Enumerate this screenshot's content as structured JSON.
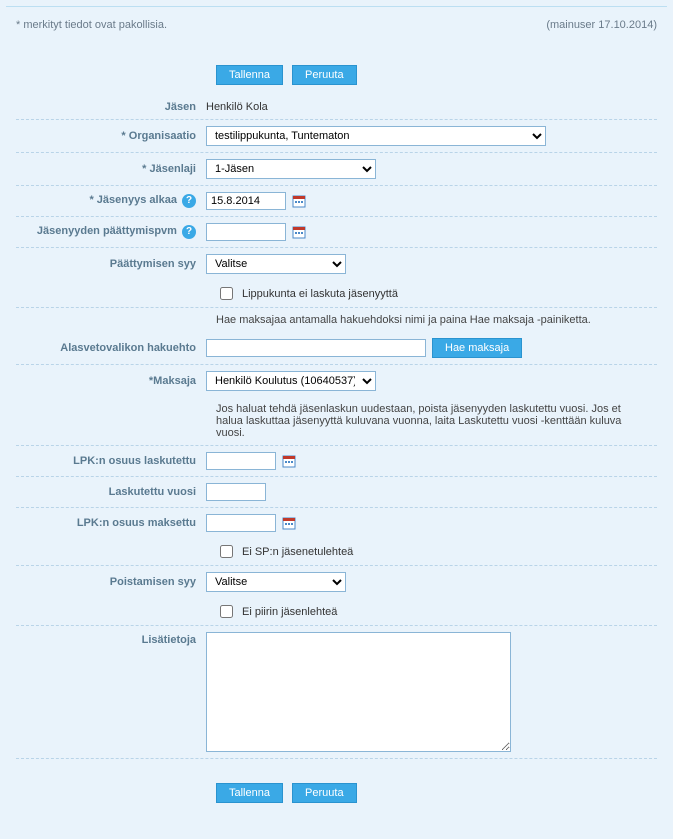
{
  "header": {
    "mandatory_note": "* merkityt tiedot ovat pakollisia.",
    "meta": "(mainuser 17.10.2014)"
  },
  "buttons": {
    "save": "Tallenna",
    "cancel": "Peruuta",
    "search_payer": "Hae maksaja"
  },
  "icons": {
    "help": "?"
  },
  "fields": {
    "member": {
      "label": "Jäsen",
      "value": "Henkilö Kola"
    },
    "organisation": {
      "label": "* Organisaatio",
      "selected": "testilippukunta, Tuntematon"
    },
    "membertype": {
      "label": "* Jäsenlaji",
      "selected": "1-Jäsen"
    },
    "start": {
      "label": "* Jäsenyys alkaa",
      "value": "15.8.2014"
    },
    "end": {
      "label": "Jäsenyyden päättymispvm",
      "value": ""
    },
    "endreason": {
      "label": "Päättymisen syy",
      "selected": "Valitse"
    },
    "nobilling": {
      "label": "Lippukunta ei laskuta jäsenyyttä"
    },
    "searchpayer_desc": "Hae maksajaa antamalla hakuehdoksi nimi ja paina Hae maksaja -painiketta.",
    "searchterm": {
      "label": "Alasvetovalikon hakuehto",
      "value": ""
    },
    "payer": {
      "label": "*Maksaja",
      "selected": "Henkilö Koulutus (10640537)"
    },
    "invoice_desc": "Jos haluat tehdä jäsenlaskun uudestaan, poista jäsenyyden laskutettu vuosi. Jos et halua laskuttaa jäsenyyttä kuluvana vuonna, laita Laskutettu vuosi -kenttään kuluva vuosi.",
    "lpk_billed": {
      "label": "LPK:n osuus laskutettu",
      "value": ""
    },
    "billed_year": {
      "label": "Laskutettu vuosi",
      "value": ""
    },
    "lpk_paid": {
      "label": "LPK:n osuus maksettu",
      "value": ""
    },
    "no_sp_mag": {
      "label": "Ei SP:n jäsenetulehteä"
    },
    "removereason": {
      "label": "Poistamisen syy",
      "selected": "Valitse"
    },
    "no_district_mag": {
      "label": "Ei piirin jäsenlehteä"
    },
    "info": {
      "label": "Lisätietoja",
      "value": ""
    }
  }
}
